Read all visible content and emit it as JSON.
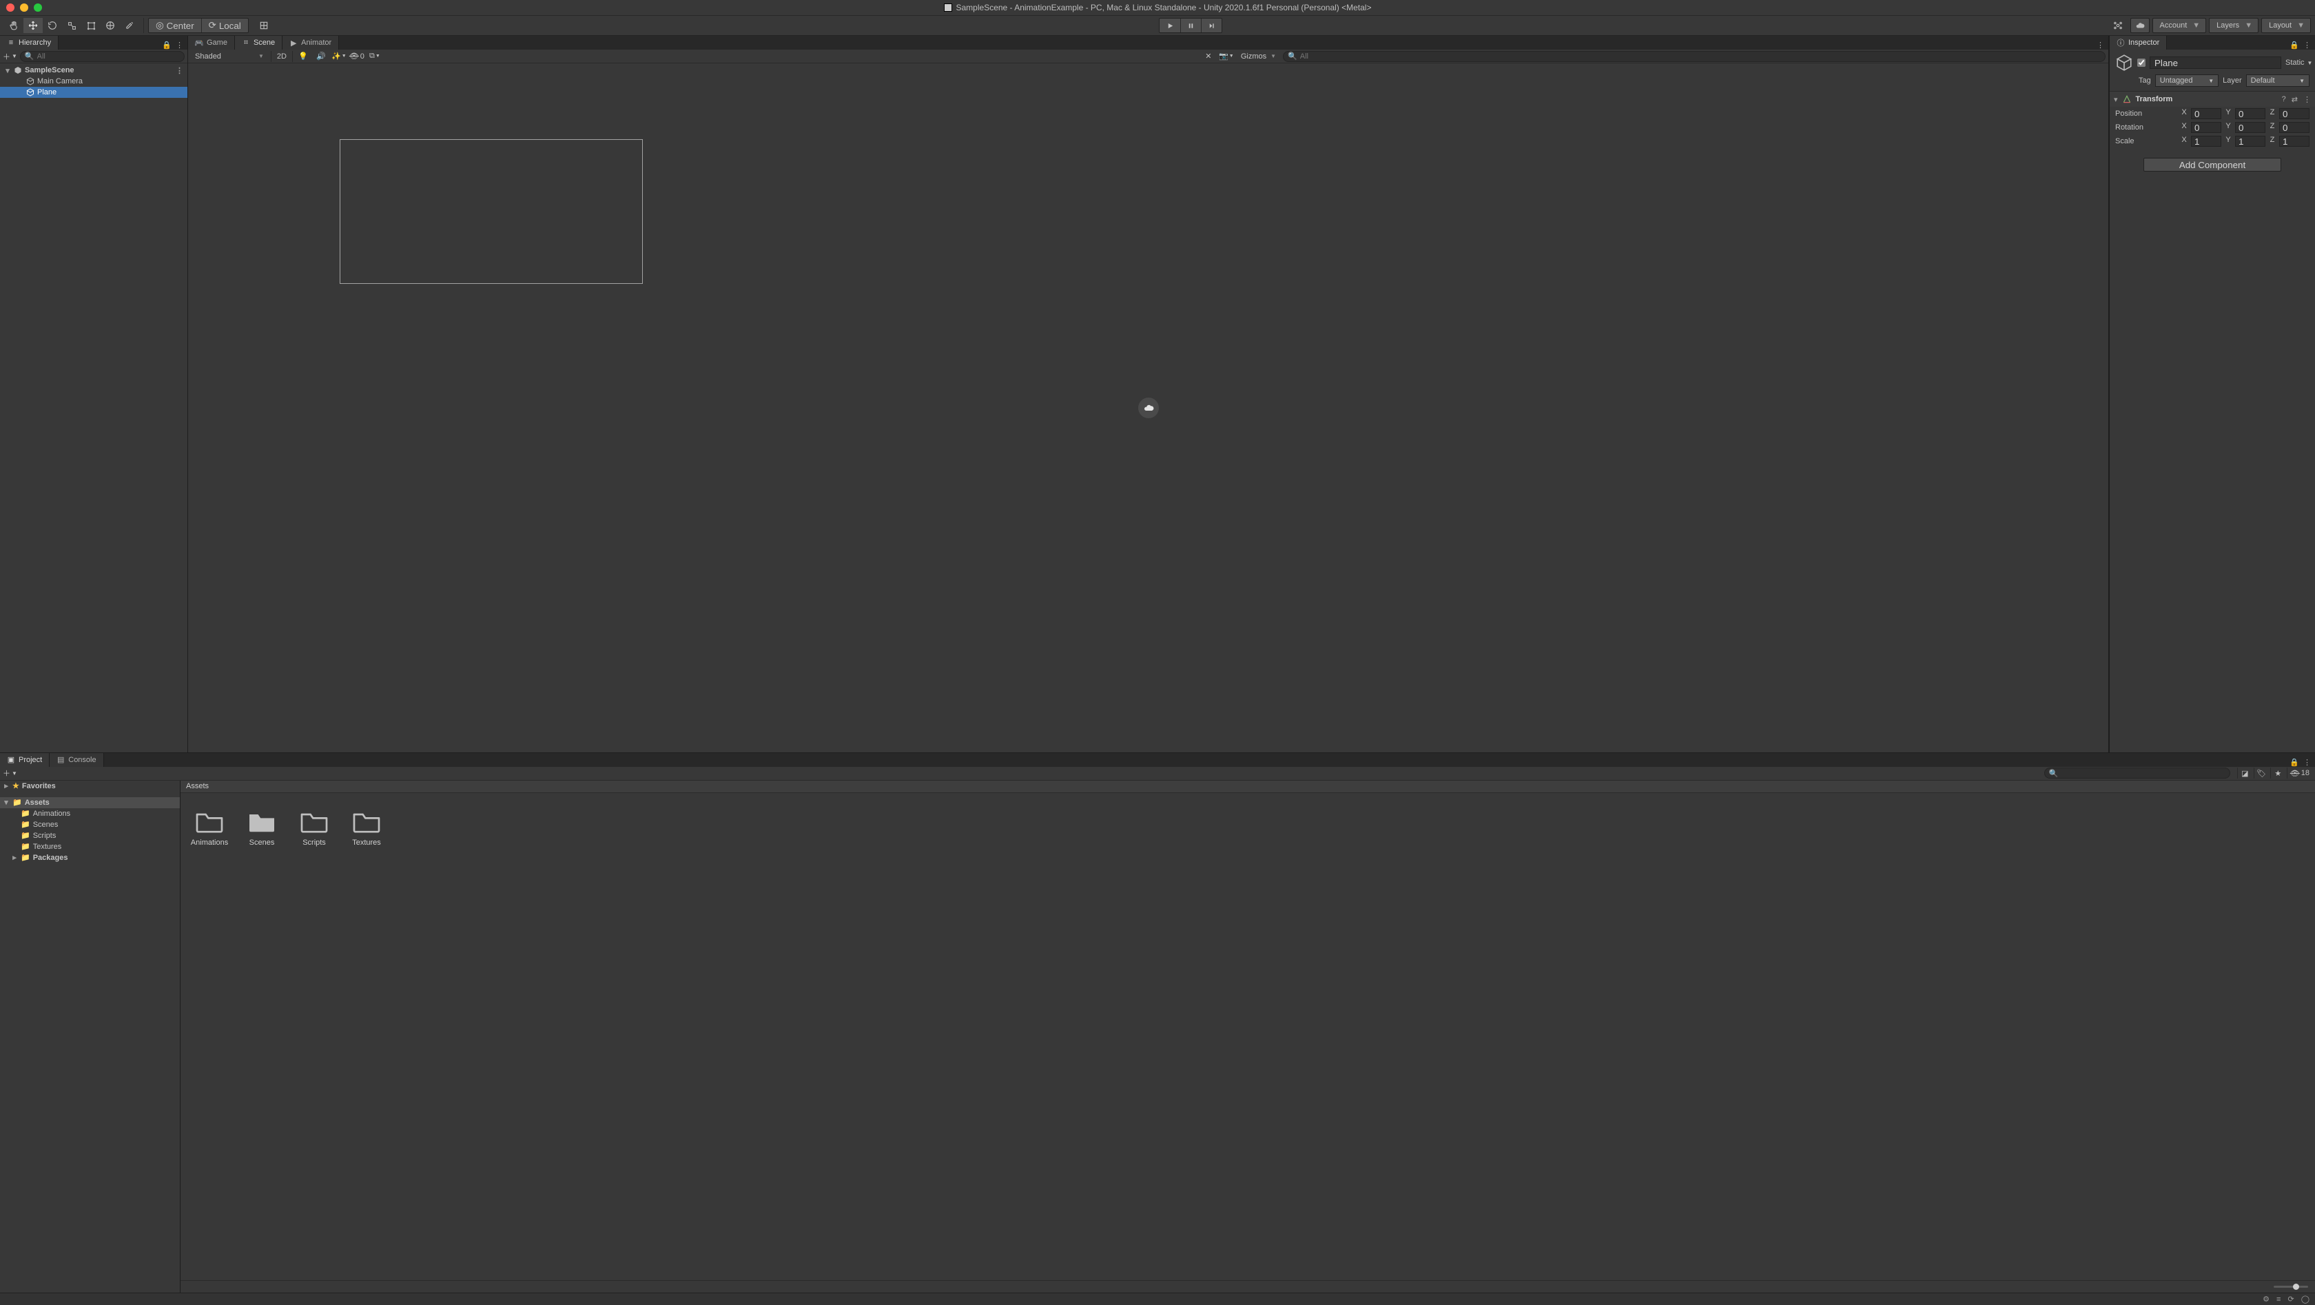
{
  "window": {
    "title": "SampleScene - AnimationExample - PC, Mac & Linux Standalone - Unity 2020.1.6f1 Personal (Personal) <Metal>"
  },
  "toolbar": {
    "pivot_handle": "Center",
    "rotation_handle": "Local",
    "account": "Account",
    "layers": "Layers",
    "layout": "Layout"
  },
  "hierarchy": {
    "tab": "Hierarchy",
    "search_placeholder": "All",
    "scene": "SampleScene",
    "items": [
      "Main Camera",
      "Plane"
    ],
    "selected_index": 1
  },
  "scene_tabs": {
    "game": "Game",
    "scene": "Scene",
    "animator": "Animator"
  },
  "scene_toolbar": {
    "draw_mode": "Shaded",
    "mode_2d": "2D",
    "lighting_count": "0",
    "gizmos": "Gizmos",
    "search_placeholder": "All"
  },
  "inspector": {
    "tab": "Inspector",
    "object_name": "Plane",
    "static": "Static",
    "tag_label": "Tag",
    "tag_value": "Untagged",
    "layer_label": "Layer",
    "layer_value": "Default",
    "transform": {
      "title": "Transform",
      "rows": {
        "position": {
          "label": "Position",
          "x": "0",
          "y": "0",
          "z": "0"
        },
        "rotation": {
          "label": "Rotation",
          "x": "0",
          "y": "0",
          "z": "0"
        },
        "scale": {
          "label": "Scale",
          "x": "1",
          "y": "1",
          "z": "1"
        }
      }
    },
    "add_component": "Add Component"
  },
  "project": {
    "tab_project": "Project",
    "tab_console": "Console",
    "hidden_count": "18",
    "favorites": "Favorites",
    "assets": "Assets",
    "packages": "Packages",
    "asset_children": [
      "Animations",
      "Scenes",
      "Scripts",
      "Textures"
    ],
    "breadcrumb": "Assets",
    "grid": [
      "Animations",
      "Scenes",
      "Scripts",
      "Textures"
    ]
  }
}
